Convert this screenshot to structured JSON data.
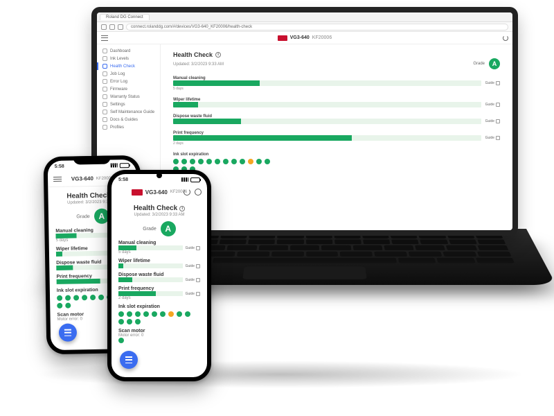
{
  "browser": {
    "tab_title": "Roland DG Connect",
    "url": "connect.rolanddg.com/#/devices/VG3-640_KF20006/health-check"
  },
  "device": {
    "model": "VG3-640",
    "serial": "KF20006"
  },
  "sidebar": {
    "items": [
      {
        "label": "Dashboard"
      },
      {
        "label": "Ink Levels"
      },
      {
        "label": "Health Check"
      },
      {
        "label": "Job Log"
      },
      {
        "label": "Error Log"
      },
      {
        "label": "Firmware"
      },
      {
        "label": "Warranty Status"
      },
      {
        "label": "Settings"
      },
      {
        "label": "Self Maintenance Guide"
      },
      {
        "label": "Docs & Guides"
      },
      {
        "label": "Profiles"
      }
    ],
    "active_index": 2
  },
  "page": {
    "title": "Health Check",
    "updated": "Updated: 3/2/2023 9:33 AM",
    "updated_mobile": "Updated: 3/2/2023 9:33 AM",
    "grade_label": "Grade",
    "grade_value": "A",
    "guide_label": "Guide",
    "metrics": [
      {
        "label": "Manual cleaning",
        "sub": "5 days",
        "fill": 28
      },
      {
        "label": "Wiper lifetime",
        "sub": "",
        "fill": 8
      },
      {
        "label": "Dispose waste fluid",
        "sub": "",
        "fill": 22
      },
      {
        "label": "Print frequency",
        "sub": "2 days",
        "fill": 58
      }
    ],
    "ink_slot": {
      "label": "Ink slot expiration",
      "dots": [
        "g",
        "g",
        "g",
        "g",
        "g",
        "g",
        "g",
        "g",
        "g",
        "o",
        "g",
        "g"
      ],
      "dots_row2": [
        "g",
        "g",
        "g"
      ]
    },
    "scan_motor": {
      "label": "Scan motor",
      "sub": "Motor error: 0"
    }
  },
  "phone": {
    "time": "5:58",
    "grade_label": "Grade",
    "model": "VG3-640",
    "serial": "KF20006"
  }
}
